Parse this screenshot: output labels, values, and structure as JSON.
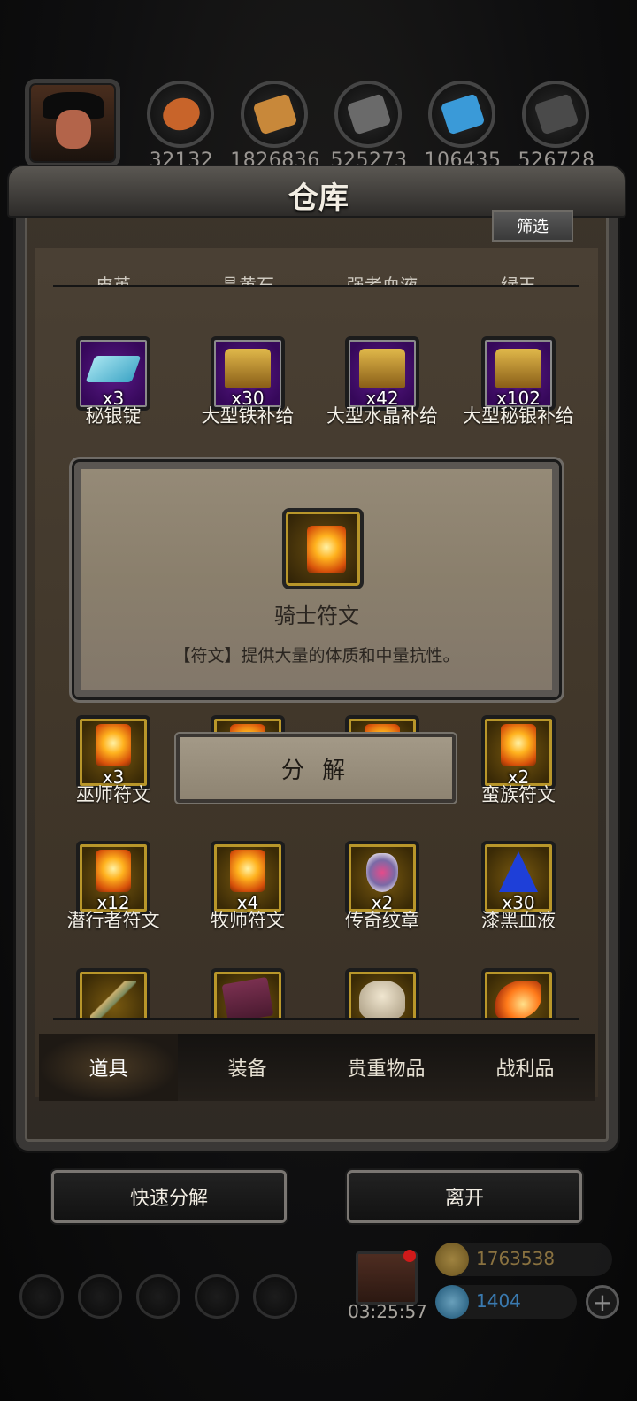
{
  "resources": [
    {
      "name": "copper-ore-icon",
      "value": "32132",
      "color": "#c8642a"
    },
    {
      "name": "wood-plank-icon",
      "value": "1826836",
      "color": "#c8883a"
    },
    {
      "name": "iron-ingot-icon",
      "value": "525273",
      "color": "#6a6a6a"
    },
    {
      "name": "blue-crystal-icon",
      "value": "106435",
      "color": "#3a9ad8"
    },
    {
      "name": "dark-steel-icon",
      "value": "526728",
      "color": "#4a4a4a"
    }
  ],
  "title": "仓库",
  "filter_label": "筛选",
  "partial_row_names": [
    "皮革",
    "晶黄石",
    "强者血液",
    "绿玉"
  ],
  "items": [
    {
      "name": "秘银锭",
      "qty": "x3",
      "art": "ingot",
      "rarity": "purple"
    },
    {
      "name": "大型铁补给",
      "qty": "x30",
      "art": "chest",
      "rarity": "purple"
    },
    {
      "name": "大型水晶补给",
      "qty": "x42",
      "art": "chest",
      "rarity": "purple"
    },
    {
      "name": "大型秘银补给",
      "qty": "x102",
      "art": "chest",
      "rarity": "purple"
    },
    {
      "name": "巫师符文",
      "qty": "x3",
      "art": "rune",
      "rarity": "gold"
    },
    {
      "name": "蛮族符文",
      "qty": "x2",
      "art": "rune",
      "rarity": "gold"
    },
    {
      "name": "潜行者符文",
      "qty": "x12",
      "art": "rune",
      "rarity": "gold"
    },
    {
      "name": "牧师符文",
      "qty": "x4",
      "art": "rune",
      "rarity": "gold"
    },
    {
      "name": "传奇纹章",
      "qty": "x2",
      "art": "crest",
      "rarity": "gold"
    },
    {
      "name": "漆黑血液",
      "qty": "x30",
      "art": "blood",
      "rarity": "gold"
    }
  ],
  "popup": {
    "name": "骑士符文",
    "description": "【符文】提供大量的体质和中量抗性。"
  },
  "decompose_label": "分 解",
  "tabs": [
    "道具",
    "装备",
    "贵重物品",
    "战利品"
  ],
  "active_tab": 0,
  "quick_decompose_label": "快速分解",
  "leave_label": "离开",
  "timer": "03:25:57",
  "gold_value": "1763538",
  "gem_value": "1404"
}
